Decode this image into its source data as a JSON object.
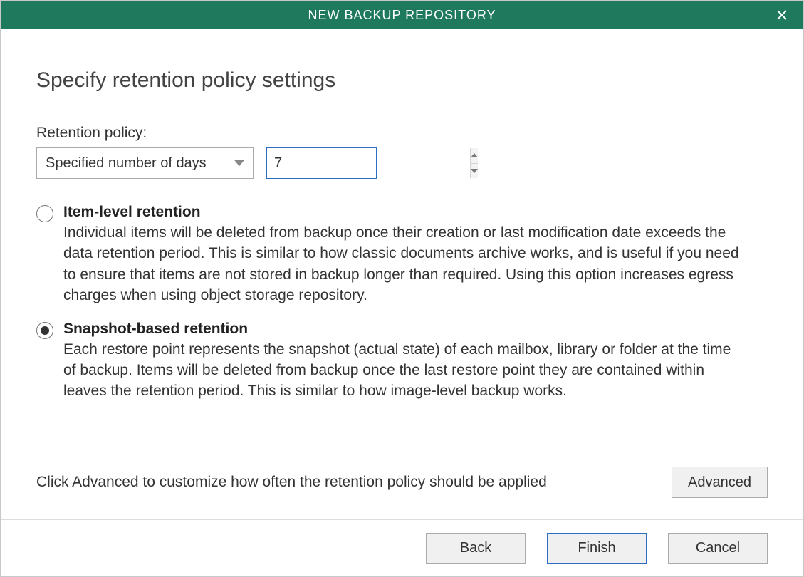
{
  "titlebar": {
    "title": "NEW BACKUP REPOSITORY"
  },
  "page": {
    "heading": "Specify retention policy settings",
    "policy_label": "Retention policy:",
    "policy_dropdown_value": "Specified number of days",
    "policy_days_value": "7"
  },
  "options": {
    "item_level": {
      "title": "Item-level retention",
      "desc": "Individual items will be deleted from backup once their creation or last modification date exceeds the data retention period. This is similar to how classic documents archive works, and is useful if you need to ensure that items are not stored in backup longer than required. Using this option increases egress charges when using object storage repository.",
      "selected": false
    },
    "snapshot": {
      "title": "Snapshot-based retention",
      "desc": "Each restore point represents the snapshot (actual state) of each mailbox, library or folder at the time of backup. Items will be deleted from backup once the last restore point they are contained within leaves the retention period. This is similar to how image-level backup works.",
      "selected": true
    }
  },
  "advanced": {
    "hint": "Click Advanced to customize how often the retention policy should be applied",
    "button": "Advanced"
  },
  "footer": {
    "back": "Back",
    "finish": "Finish",
    "cancel": "Cancel"
  }
}
